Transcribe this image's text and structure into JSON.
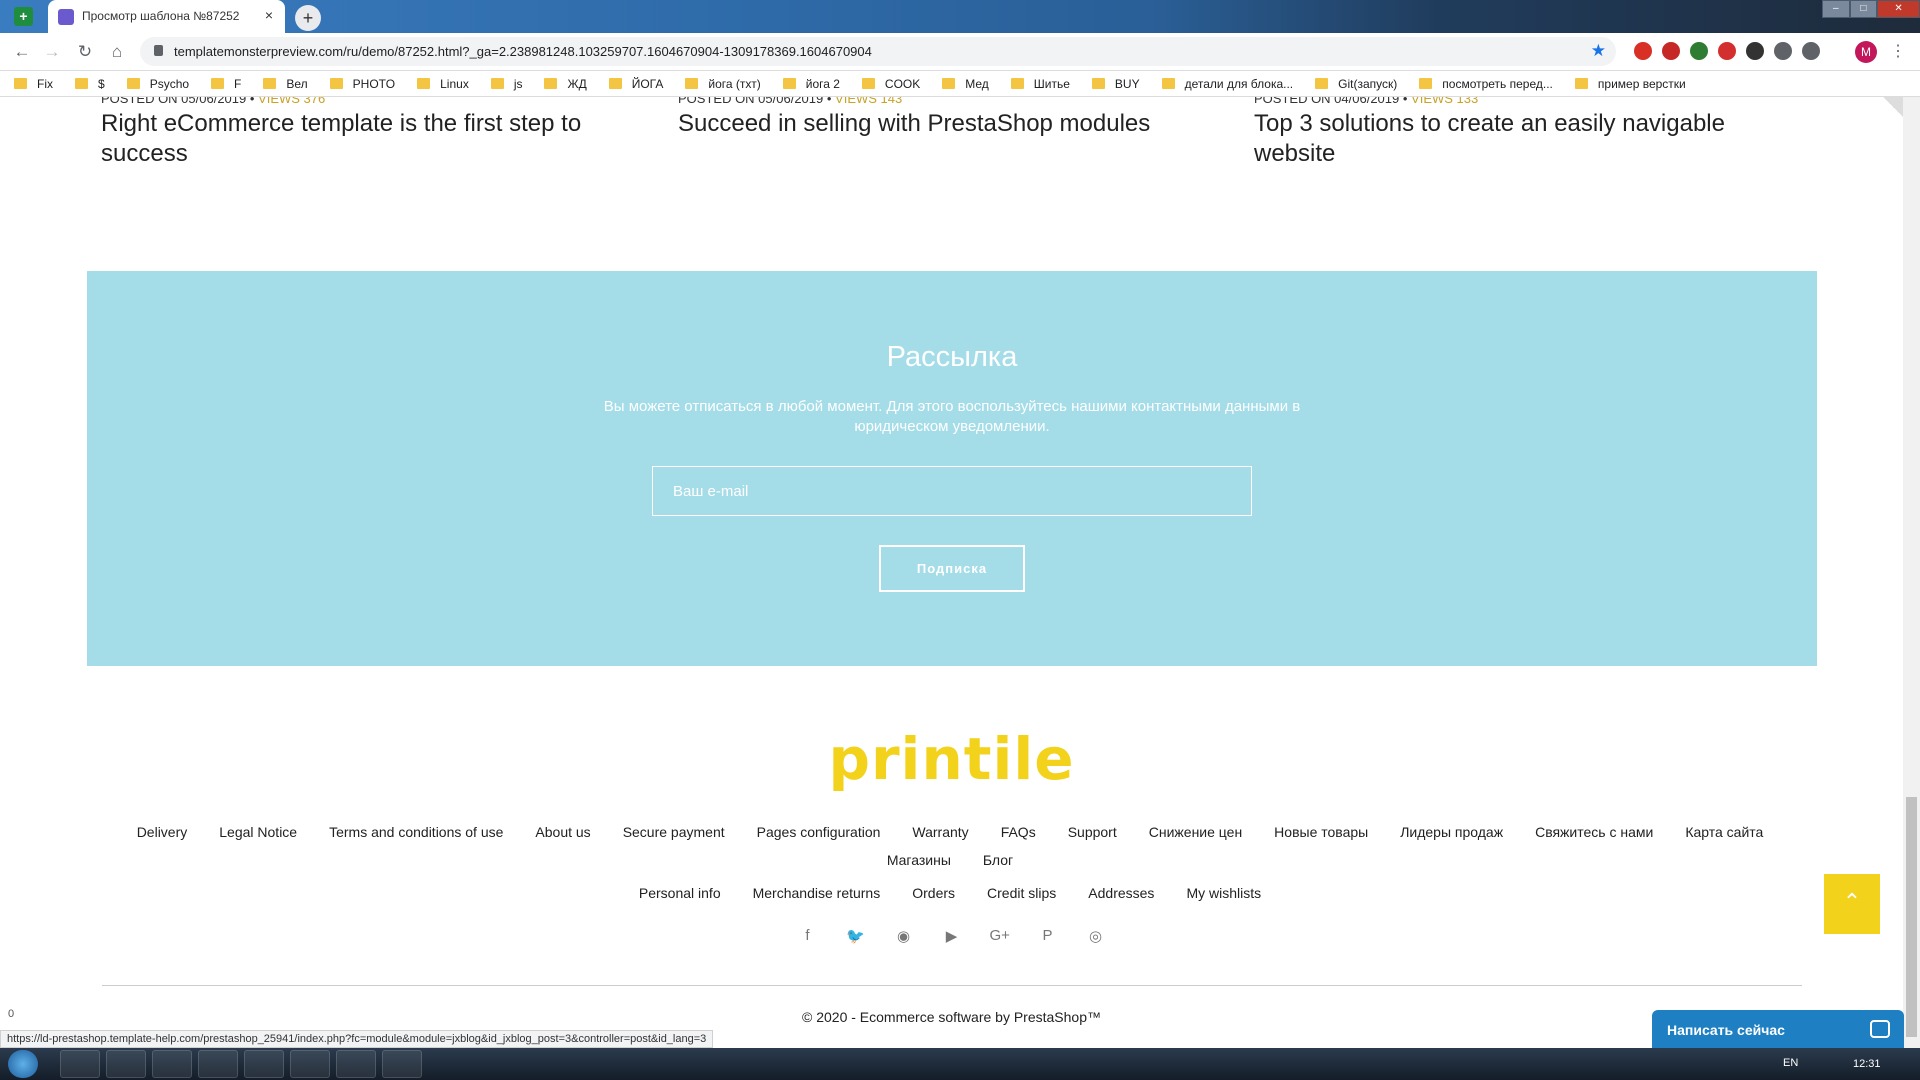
{
  "browser": {
    "tab_title": "Просмотр шаблона №87252",
    "tab_close": "×",
    "newtab": "+",
    "url": "templatemonsterpreview.com/ru/demo/87252.html?_ga=2.238981248.103259707.1604670904-1309178369.1604670904",
    "back": "←",
    "forward": "→",
    "reload": "↻",
    "home": "⌂",
    "star": "★",
    "avatar": "M",
    "menu": "⋮",
    "window_controls": [
      "–",
      "□",
      "✕"
    ]
  },
  "bookmarks": [
    "Fix",
    "$",
    "Psycho",
    "F",
    "Вел",
    "PHOTO",
    "Linux",
    "js",
    "ЖД",
    "ЙОГА",
    "йога (тхт)",
    "йога 2",
    "COOK",
    "Мед",
    "Шитье",
    "BUY",
    "детали для блока...",
    "Git(запуск)",
    "посмотреть перед...",
    "пример верстки"
  ],
  "posts": [
    {
      "meta": "POSTED ON 05/06/2019 •",
      "views": "VIEWS 376",
      "title": "Right eCommerce template is the first step to success"
    },
    {
      "meta": "POSTED ON 05/06/2019 •",
      "views": "VIEWS 143",
      "title": "Succeed in selling with PrestaShop modules"
    },
    {
      "meta": "POSTED ON 04/06/2019 •",
      "views": "VIEWS 133",
      "title": "Top 3 solutions to create an easily navigable website"
    }
  ],
  "newsletter": {
    "title": "Рассылка",
    "description": "Вы можете отписаться в любой момент. Для этого воспользуйтесь нашими контактными данными в юридическом уведомлении.",
    "email_placeholder": "Ваш e-mail",
    "button_label": "Подписка"
  },
  "footer": {
    "logo": "printile",
    "links_row1": [
      "Delivery",
      "Legal Notice",
      "Terms and conditions of use",
      "About us",
      "Secure payment",
      "Pages configuration",
      "Warranty",
      "FAQs",
      "Support",
      "Снижение цен",
      "Новые товары",
      "Лидеры продаж",
      "Свяжитесь с нами",
      "Карта сайта"
    ],
    "links_row2": [
      "Магазины",
      "Блог"
    ],
    "links_row3": [
      "Personal info",
      "Merchandise returns",
      "Orders",
      "Credit slips",
      "Addresses",
      "My wishlists"
    ],
    "social": [
      {
        "name": "facebook-icon",
        "glyph": "f"
      },
      {
        "name": "twitter-icon",
        "glyph": "🐦"
      },
      {
        "name": "rss-icon",
        "glyph": "◉"
      },
      {
        "name": "youtube-icon",
        "glyph": "▶"
      },
      {
        "name": "google-plus-icon",
        "glyph": "G+"
      },
      {
        "name": "pinterest-icon",
        "glyph": "P"
      },
      {
        "name": "instagram-icon",
        "glyph": "◎"
      }
    ],
    "copyright": "© 2020 - Ecommerce software by PrestaShop™"
  },
  "to_top": "⌃",
  "chat": {
    "label": "Написать сейчас"
  },
  "status_url": "https://ld-prestashop.template-help.com/prestashop_25941/index.php?fc=module&module=jxblog&id_jxblog_post=3&controller=post&id_lang=3",
  "net_badge": "0",
  "taskbar": {
    "lang": "EN",
    "clock": "12:31"
  },
  "colors": {
    "newsletter_bg": "#a4dde8",
    "logo": "#f2d21b",
    "chat": "#1e7fc3",
    "views": "#c9a227"
  }
}
